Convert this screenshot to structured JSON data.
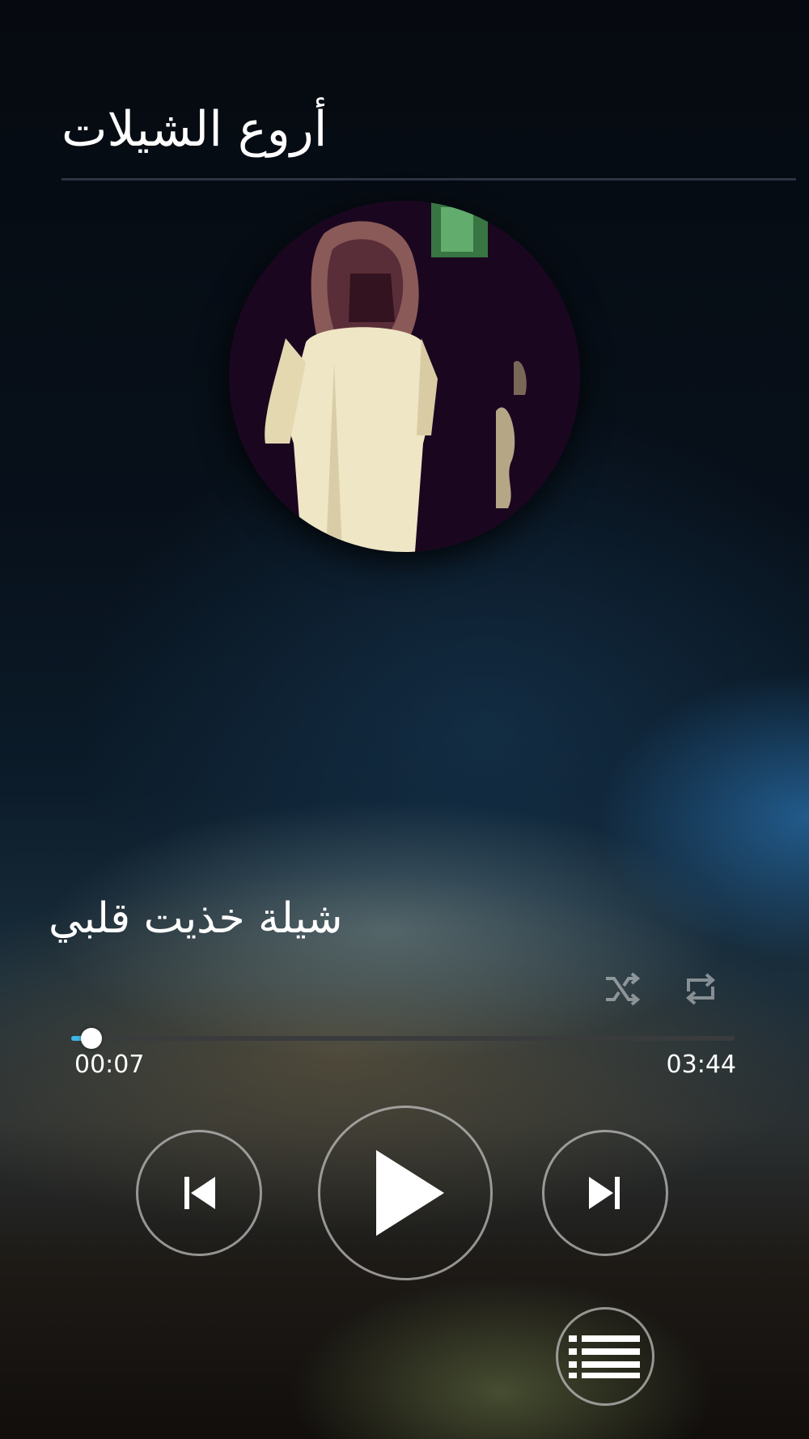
{
  "header": {
    "title": "أروع الشيلات"
  },
  "album": {
    "art_icon": "album-art-image"
  },
  "track": {
    "title": "شيلة خذيت قلبي",
    "elapsed": "00:07",
    "duration": "03:44",
    "progress_fraction": 0.031
  },
  "modes": {
    "shuffle_icon": "shuffle-icon",
    "repeat_icon": "repeat-icon"
  },
  "controls": {
    "previous_icon": "skip-previous-icon",
    "play_icon": "play-icon",
    "next_icon": "skip-next-icon",
    "playlist_icon": "playlist-icon"
  },
  "colors": {
    "accent": "#3fb6e6",
    "track": "#3a3b3c",
    "divider": "#2d3442"
  }
}
